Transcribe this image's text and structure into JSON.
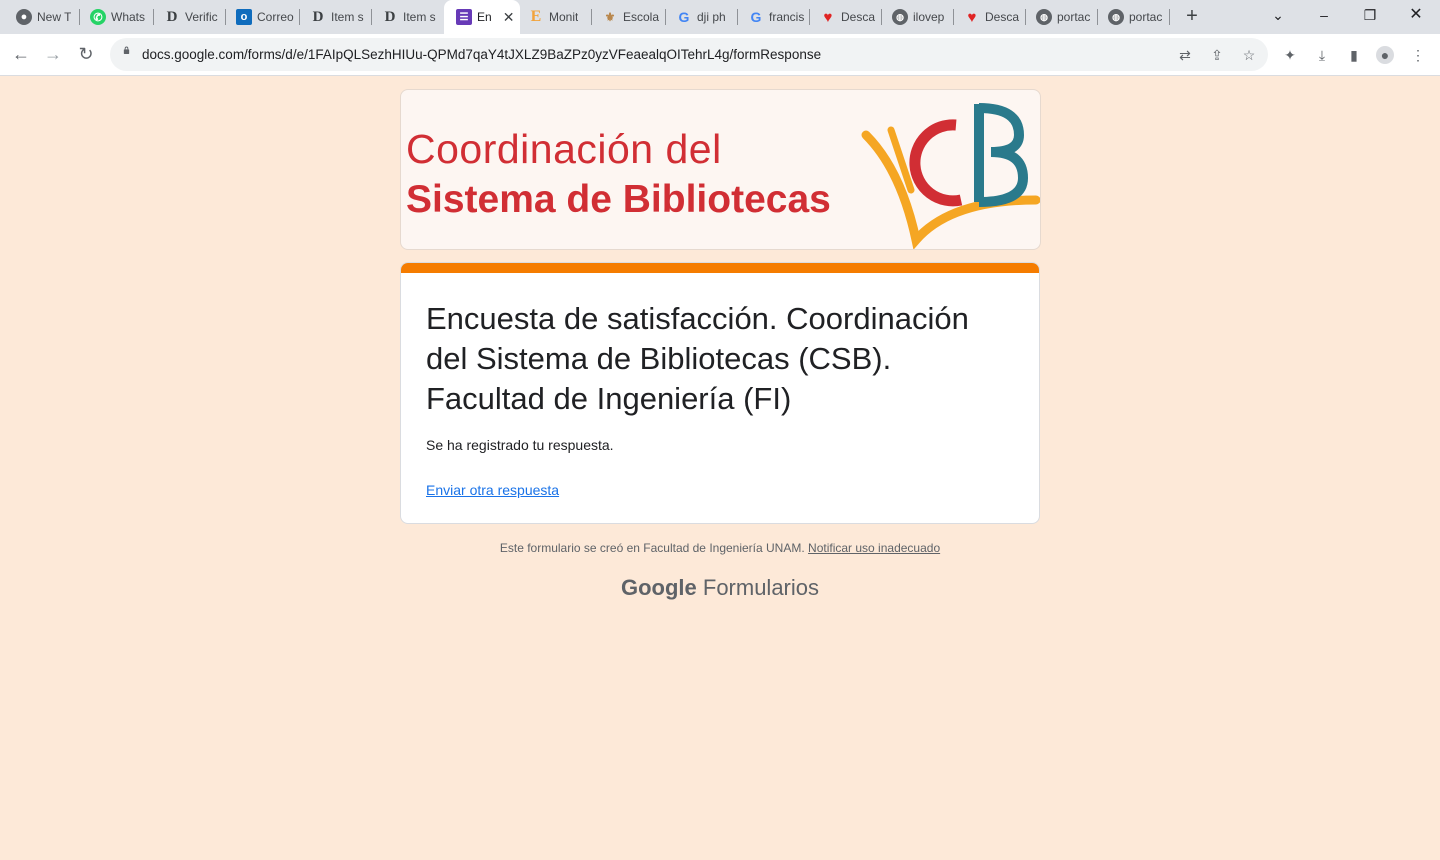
{
  "tabs": [
    {
      "title": "New T",
      "icon": "chrome-icon"
    },
    {
      "title": "Whats",
      "icon": "whatsapp-icon"
    },
    {
      "title": "Verific",
      "icon": "d-logo-icon"
    },
    {
      "title": "Correo",
      "icon": "outlook-icon"
    },
    {
      "title": "Item s",
      "icon": "d-logo-icon"
    },
    {
      "title": "Item s",
      "icon": "d-logo-icon"
    },
    {
      "title": "En",
      "icon": "google-forms-icon"
    },
    {
      "title": "Monit",
      "icon": "e-logo-icon"
    },
    {
      "title": "Escola",
      "icon": "unam-icon"
    },
    {
      "title": "dji ph",
      "icon": "google-icon"
    },
    {
      "title": "francis",
      "icon": "google-icon"
    },
    {
      "title": "Desca",
      "icon": "heart-icon"
    },
    {
      "title": "ilovep",
      "icon": "globe-icon"
    },
    {
      "title": "Desca",
      "icon": "heart-icon"
    },
    {
      "title": "portac",
      "icon": "globe-icon"
    },
    {
      "title": "portac",
      "icon": "globe-icon"
    }
  ],
  "address_bar": {
    "url": "docs.google.com/forms/d/e/1FAIpQLSezhHIUu-QPMd7qaY4tJXLZ9BaZPz0yzVFeaealqOITehrL4g/formResponse"
  },
  "banner": {
    "line1": "Coordinación del",
    "line2": "Sistema de Bibliotecas",
    "logo_text": "CB"
  },
  "form": {
    "title": "Encuesta de satisfacción. Coordinación del Sistema de Bibliotecas (CSB).    Facultad de Ingeniería (FI)",
    "message": "Se ha registrado tu respuesta.",
    "link": "Enviar otra respuesta"
  },
  "footer": {
    "text": "Este formulario se creó en Facultad de Ingeniería UNAM.",
    "report_link": "Notificar uso inadecuado"
  },
  "brand": {
    "google": "Google",
    "product": "Formularios"
  },
  "colors": {
    "page_bg": "#fde9d8",
    "accent": "#f57c00",
    "banner_red": "#d12e34",
    "link": "#1a73e8"
  }
}
